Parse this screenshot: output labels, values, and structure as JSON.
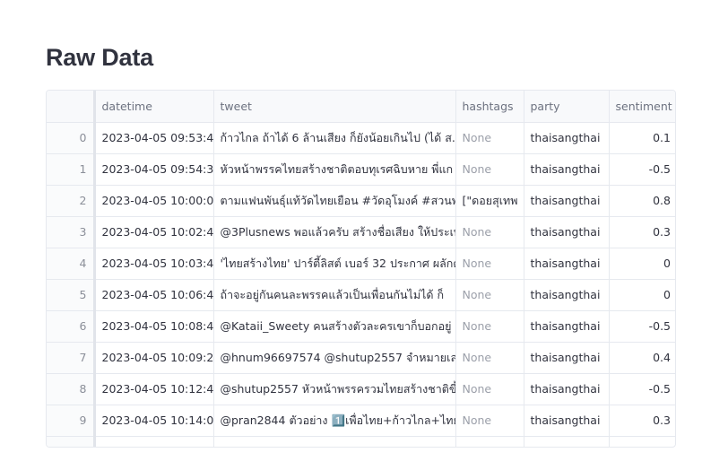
{
  "page": {
    "title": "Raw Data"
  },
  "table": {
    "columns": [
      "",
      "datetime",
      "tweet",
      "hashtags",
      "party",
      "sentiment"
    ],
    "rows": [
      {
        "index": "0",
        "datetime": "2023-04-05 09:53:40",
        "tweet": "ก้าวไกล ถ้าได้ 6 ล้านเสียง ก็ยังน้อยเกินไป (ได้ ส.ส.",
        "hashtags": "None",
        "party": "thaisangthai",
        "sentiment": "0.1"
      },
      {
        "index": "1",
        "datetime": "2023-04-05 09:54:38",
        "tweet": "หัวหน้าพรรคไทยสร้างชาติตอบทุเรศฉิบหาย พี่แก",
        "hashtags": "None",
        "party": "thaisangthai",
        "sentiment": "-0.5"
      },
      {
        "index": "2",
        "datetime": "2023-04-05 10:00:00",
        "tweet": "ตามแฟนพันธุ์แท้วัดไทยเยือน #วัดอุโมงค์ #สวนพุทธ",
        "hashtags": "[\"ดอยสุเทพ",
        "party": "thaisangthai",
        "sentiment": "0.8"
      },
      {
        "index": "3",
        "datetime": "2023-04-05 10:02:48",
        "tweet": "@3Plusnews พอแล้วครับ สร้างชื่อเสียง ให้ประเทศ",
        "hashtags": "None",
        "party": "thaisangthai",
        "sentiment": "0.3"
      },
      {
        "index": "4",
        "datetime": "2023-04-05 10:03:49",
        "tweet": "'ไทยสร้างไทย' ปาร์ตี้ลิสต์ เบอร์ 32 ประกาศ ผลักดัน",
        "hashtags": "None",
        "party": "thaisangthai",
        "sentiment": "0"
      },
      {
        "index": "5",
        "datetime": "2023-04-05 10:06:48",
        "tweet": "ถ้าจะอยู่กันคนละพรรคแล้วเป็นเพื่อนกันไม่ได้ ก็",
        "hashtags": "None",
        "party": "thaisangthai",
        "sentiment": "0"
      },
      {
        "index": "6",
        "datetime": "2023-04-05 10:08:43",
        "tweet": "@Kataii_Sweety คนสร้างตัวละครเขาก็บอกอยู่",
        "hashtags": "None",
        "party": "thaisangthai",
        "sentiment": "-0.5"
      },
      {
        "index": "7",
        "datetime": "2023-04-05 10:09:21",
        "tweet": "@hnum96697574 @shutup2557 จำหมายเลขพรรค",
        "hashtags": "None",
        "party": "thaisangthai",
        "sentiment": "0.4"
      },
      {
        "index": "8",
        "datetime": "2023-04-05 10:12:49",
        "tweet": "@shutup2557 หัวหน้าพรรครวมไทยสร้างชาติขึ้น",
        "hashtags": "None",
        "party": "thaisangthai",
        "sentiment": "-0.5"
      },
      {
        "index": "9",
        "datetime": "2023-04-05 10:14:01",
        "tweet": "@pran2844 ตัวอย่าง 1️⃣เพื่อไทย+ก้าวไกล+ไทยสร้าง",
        "hashtags": "None",
        "party": "thaisangthai",
        "sentiment": "0.3"
      }
    ]
  }
}
